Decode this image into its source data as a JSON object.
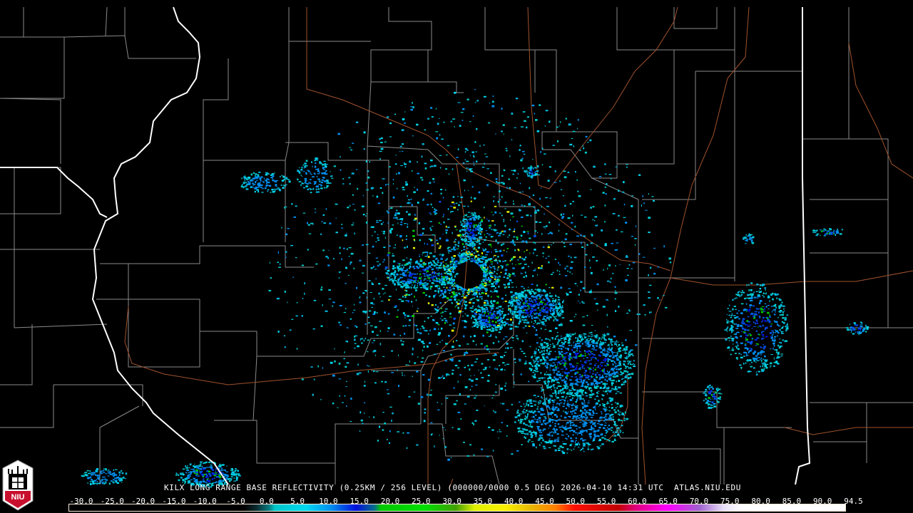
{
  "caption": "KILX LONG RANGE BASE REFLECTIVITY (0.25KM / 256 LEVEL) (000000/0000 0.5 DEG) 2026-04-10 14:31 UTC  ATLAS.NIU.EDU",
  "logo": {
    "text": "NIU"
  },
  "scale": {
    "labels": [
      "-30.0",
      "-25.0",
      "-20.0",
      "-15.0",
      "-10.0",
      "-5.0",
      "0.0",
      "5.0",
      "10.0",
      "15.0",
      "20.0",
      "25.0",
      "30.0",
      "35.0",
      "40.0",
      "45.0",
      "50.0",
      "55.0",
      "60.0",
      "65.0",
      "70.0",
      "75.0",
      "80.0",
      "85.0",
      "90.0",
      "94.5"
    ],
    "min": -30,
    "max": 94.5,
    "colors": [
      {
        "v": -30,
        "c": "#000000"
      },
      {
        "v": -2,
        "c": "#000000"
      },
      {
        "v": 0,
        "c": "#0a2a2e"
      },
      {
        "v": 2,
        "c": "#08787c"
      },
      {
        "v": 3,
        "c": "#00c8c8"
      },
      {
        "v": 8,
        "c": "#00d8f0"
      },
      {
        "v": 12,
        "c": "#0090f0"
      },
      {
        "v": 16,
        "c": "#0010e0"
      },
      {
        "v": 19,
        "c": "#086e8a"
      },
      {
        "v": 20,
        "c": "#00c800"
      },
      {
        "v": 27,
        "c": "#00e000"
      },
      {
        "v": 32,
        "c": "#40a000"
      },
      {
        "v": 35,
        "c": "#e0f000"
      },
      {
        "v": 40,
        "c": "#f8f000"
      },
      {
        "v": 44,
        "c": "#e8b800"
      },
      {
        "v": 48,
        "c": "#ff8000"
      },
      {
        "v": 51,
        "c": "#ff1000"
      },
      {
        "v": 58,
        "c": "#c00000"
      },
      {
        "v": 61,
        "c": "#e00080"
      },
      {
        "v": 66,
        "c": "#ff00ff"
      },
      {
        "v": 71,
        "c": "#a060d0"
      },
      {
        "v": 75,
        "c": "#e8e0f8"
      },
      {
        "v": 78,
        "c": "#ffffff"
      },
      {
        "v": 94.5,
        "c": "#ffffff"
      }
    ]
  },
  "colors": {
    "county": "#8a8a8a",
    "state": "#ffffff",
    "highway": "#a0522d"
  }
}
